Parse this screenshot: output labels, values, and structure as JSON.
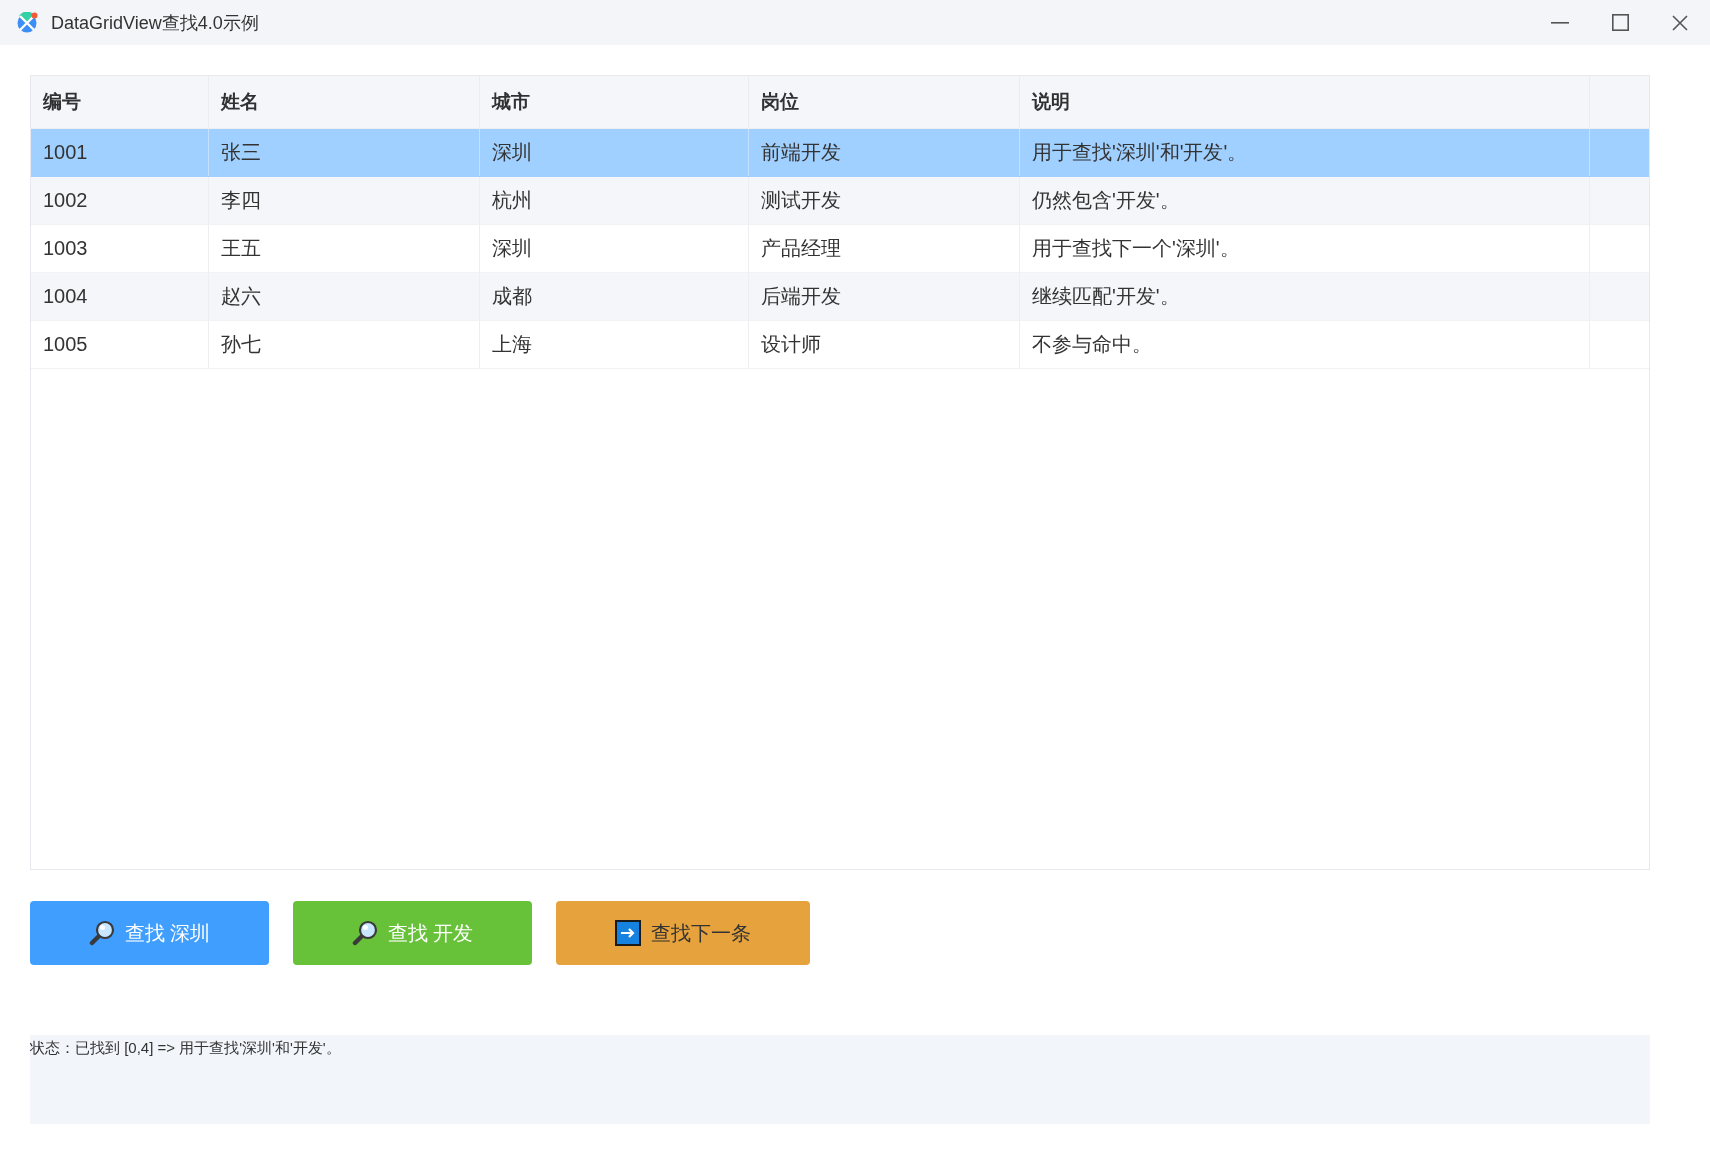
{
  "window": {
    "title": "DataGridView查找4.0示例"
  },
  "table": {
    "columns": [
      "编号",
      "姓名",
      "城市",
      "岗位",
      "说明"
    ],
    "rows": [
      {
        "cells": [
          "1001",
          "张三",
          "深圳",
          "前端开发",
          "用于查找'深圳'和'开发'。"
        ],
        "selected": true
      },
      {
        "cells": [
          "1002",
          "李四",
          "杭州",
          "测试开发",
          "仍然包含'开发'。"
        ],
        "selected": false
      },
      {
        "cells": [
          "1003",
          "王五",
          "深圳",
          "产品经理",
          "用于查找下一个'深圳'。"
        ],
        "selected": false
      },
      {
        "cells": [
          "1004",
          "赵六",
          "成都",
          "后端开发",
          "继续匹配'开发'。"
        ],
        "selected": false
      },
      {
        "cells": [
          "1005",
          "孙七",
          "上海",
          "设计师",
          "不参与命中。"
        ],
        "selected": false
      }
    ]
  },
  "buttons": [
    {
      "label": "查找 深圳",
      "kind": "search",
      "color": "#409eff"
    },
    {
      "label": "查找 开发",
      "kind": "search",
      "color": "#67c23a"
    },
    {
      "label": "查找下一条",
      "kind": "next",
      "color": "#e6a23c"
    }
  ],
  "status_bar": {
    "text": "状态：已找到 [0,4] => 用于查找'深圳'和'开发'。"
  }
}
